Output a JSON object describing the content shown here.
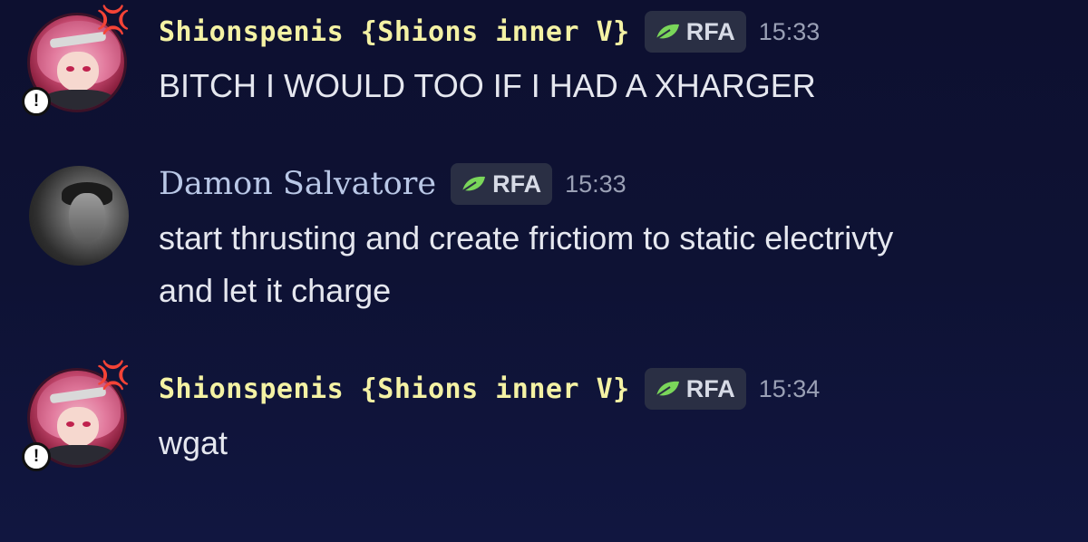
{
  "colors": {
    "background": "#0e1234",
    "username_pixel": "#f4f2a4",
    "username_serif": "#b9c7e6",
    "tag_bg": "#2a2f44",
    "leaf": "#7ad65a",
    "text": "#e5e7ef",
    "timestamp": "#9aa0b5"
  },
  "messages": [
    {
      "username": "Shionspenis {Shions inner V}",
      "tag": "RFA",
      "tag_icon": "leaf-icon",
      "timestamp": "15:33",
      "lines": [
        "BITCH I WOULD TOO IF I HAD A XHARGER"
      ],
      "avatar_badges": [
        "anger-icon",
        "alert-icon"
      ]
    },
    {
      "username": "Damon Salvatore",
      "tag": "RFA",
      "tag_icon": "leaf-icon",
      "timestamp": "15:33",
      "lines": [
        "start thrusting and create frictiom to static electrivty",
        "and let it charge"
      ]
    },
    {
      "username": "Shionspenis {Shions inner V}",
      "tag": "RFA",
      "tag_icon": "leaf-icon",
      "timestamp": "15:34",
      "lines": [
        "wgat"
      ],
      "avatar_badges": [
        "anger-icon",
        "alert-icon"
      ]
    }
  ],
  "icons": {
    "anger": "💢",
    "alert": "!"
  }
}
